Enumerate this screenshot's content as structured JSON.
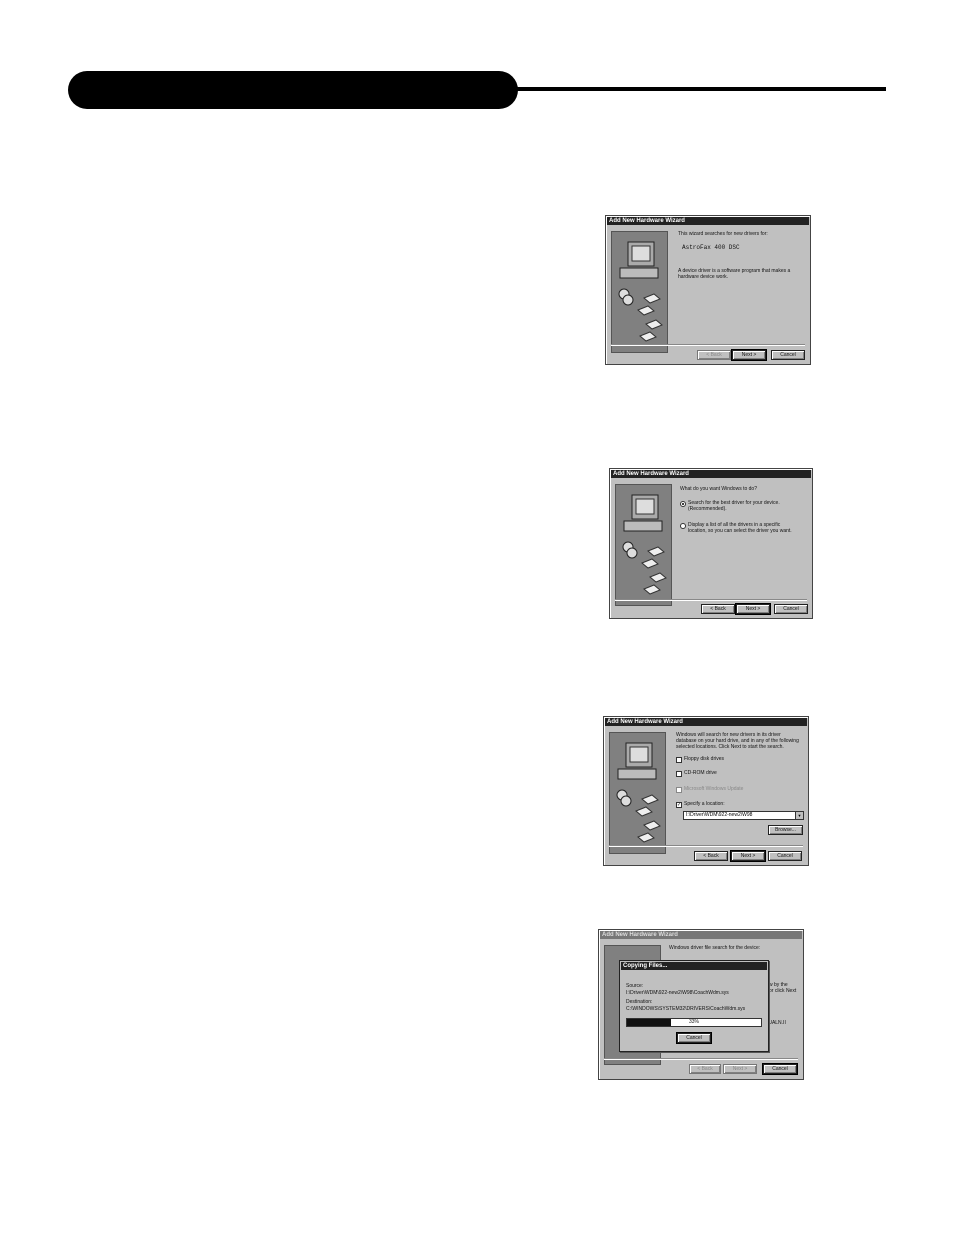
{
  "dialog1": {
    "title": "Add New Hardware Wizard",
    "intro": "This wizard searches for new drivers for:",
    "device": "AstroFax 400 DSC",
    "desc": "A device driver is a software program that makes a hardware device work.",
    "buttons": {
      "back": "< Back",
      "next": "Next >",
      "cancel": "Cancel"
    }
  },
  "dialog2": {
    "title": "Add New Hardware Wizard",
    "question": "What do you want Windows to do?",
    "option1": "Search for the best driver for your device. (Recommended).",
    "option2": "Display a list of all the drivers in a specific location, so you can select the driver you want.",
    "buttons": {
      "back": "< Back",
      "next": "Next >",
      "cancel": "Cancel"
    }
  },
  "dialog3": {
    "title": "Add New Hardware Wizard",
    "intro": "Windows will search for new drivers in its driver database on your hard drive, and in any of the following selected locations. Click Next to start the search.",
    "options": [
      "Floppy disk drives",
      "CD-ROM drive",
      "Microsoft Windows Update",
      "Specify a location:"
    ],
    "checked": [
      false,
      false,
      false,
      true
    ],
    "location": "I:\\Driver\\WDM\\922-new2\\W98",
    "browse": "Browse...",
    "buttons": {
      "back": "< Back",
      "next": "Next >",
      "cancel": "Cancel"
    }
  },
  "dialog4": {
    "title": "Add New Hardware Wizard",
    "bg_text": "Windows driver file search for the device:",
    "bg_side1": "w by the",
    "bg_side2": "or click Next",
    "bg_side3": "EUALN.II",
    "copy": {
      "title": "Copying Files...",
      "source_label": "Source:",
      "source": "I:\\Driver\\WDM\\922-new2\\W98\\CoachWdm.sys",
      "dest_label": "Destination:",
      "dest": "C:\\WINDOWS\\SYSTEM32\\DRIVERS\\CoachWdm.sys",
      "percent": "33%",
      "progress": 0.33,
      "cancel": "Cancel"
    },
    "buttons": {
      "back": "< Back",
      "next": "Next >",
      "cancel": "Cancel"
    }
  }
}
